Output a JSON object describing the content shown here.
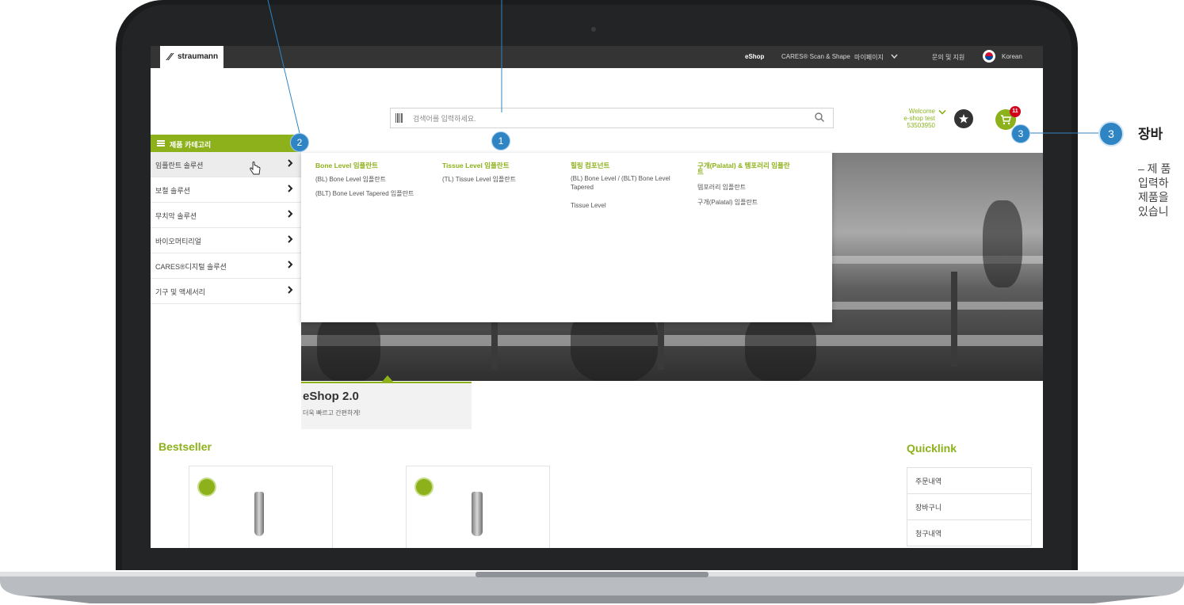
{
  "topbar": {
    "logo": "straumann",
    "nav": [
      "eShop",
      "CARES® Scan & Shape",
      "마이페이지",
      "문의 및 지원",
      "Korean"
    ]
  },
  "search": {
    "placeholder": "검색어를 입력하세요."
  },
  "account": {
    "welcome": "Welcome",
    "user": "e-shop test",
    "customer_no": "53503950",
    "cart_count": "11"
  },
  "category_menu": {
    "header": "제품 카테고리",
    "items": [
      "임플란트 솔루션",
      "보철 솔루션",
      "무치악 솔루션",
      "바이오머티리얼",
      "CARES®디지털 솔루션",
      "기구 및 액세서리"
    ]
  },
  "mega_menu": {
    "columns": [
      {
        "heading": "Bone Level 임플란트",
        "links": [
          "(BL) Bone Level 임플란트",
          "(BLT) Bone Level Tapered 임플란트"
        ]
      },
      {
        "heading": "Tissue Level 임플란트",
        "links": [
          "(TL) Tissue Level 임플란트"
        ]
      },
      {
        "heading": "힐링 컴포넌트",
        "links": [
          "(BL) Bone Level / (BLT) Bone Level",
          "Tapered",
          "Tissue Level"
        ]
      },
      {
        "heading_line1": "구개(Palatal) & 템포러리 임플란",
        "heading_line2": "트",
        "links": [
          "템포러리 임플란트",
          "구개(Palatal) 임플란트"
        ]
      }
    ]
  },
  "hero": {
    "title": "eShop 2.0",
    "subtitle": "더욱 빠르고 간편하게!"
  },
  "bestseller": {
    "title": "Bestseller"
  },
  "quicklink": {
    "title": "Quicklink",
    "items": [
      "주문내역",
      "장바구니",
      "청구내역"
    ]
  },
  "callouts": {
    "m1": "1",
    "m2": "2",
    "m3": "3",
    "right_number": "3",
    "right_title": "장바",
    "right_desc": [
      "– 제 품",
      "입력하",
      "제품을",
      "있습니"
    ]
  },
  "colors": {
    "brand_green": "#8cb11a",
    "topbar": "#343434",
    "callout_blue": "#2f84c4"
  }
}
